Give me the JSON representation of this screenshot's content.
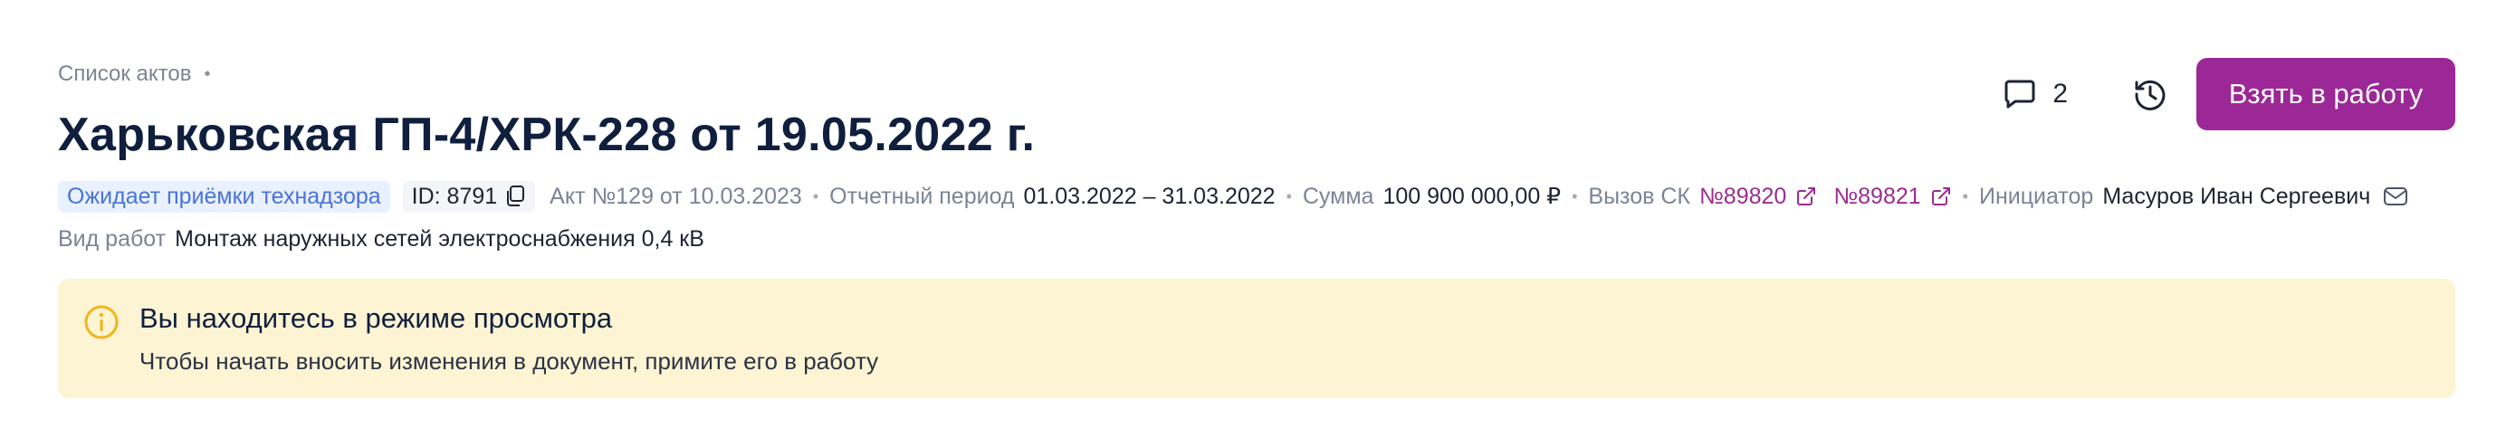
{
  "breadcrumb": {
    "label": "Список актов",
    "separator": "•"
  },
  "header": {
    "title": "Харьковская ГП-4/ХРК-228 от 19.05.2022 г."
  },
  "actions": {
    "comments_count": "2",
    "take_to_work_label": "Взять в работу"
  },
  "meta": {
    "status": "Ожидает приёмки технадзора",
    "id": "ID: 8791",
    "act": "Акт №129 от 10.03.2023",
    "period_label": "Отчетный период",
    "period_value": "01.03.2022 – 31.03.2022",
    "sum_label": "Сумма",
    "sum_value": "100 900 000,00 ₽",
    "call_label": "Вызов СК",
    "call_links": [
      "№89820",
      "№89821"
    ],
    "initiator_label": "Инициатор",
    "initiator_value": "Масуров Иван Сергеевич",
    "separator": "•"
  },
  "work": {
    "label": "Вид работ",
    "value": "Монтаж наружных сетей электроснабжения 0,4 кВ"
  },
  "alert": {
    "title": "Вы находитесь в режиме просмотра",
    "text": "Чтобы начать вносить изменения в документ, примите его в работу"
  },
  "colors": {
    "accent": "#9b2896",
    "link": "#9b2d8f",
    "status_bg": "#e9f0ff",
    "status_text": "#4a73d6",
    "alert_bg": "#fdf4d3",
    "alert_icon": "#f2b418"
  },
  "icons": {
    "comment": "comment-icon",
    "history": "history-icon",
    "copy": "copy-icon",
    "external_link": "external-link-icon",
    "mail": "mail-icon",
    "info": "info-icon"
  }
}
